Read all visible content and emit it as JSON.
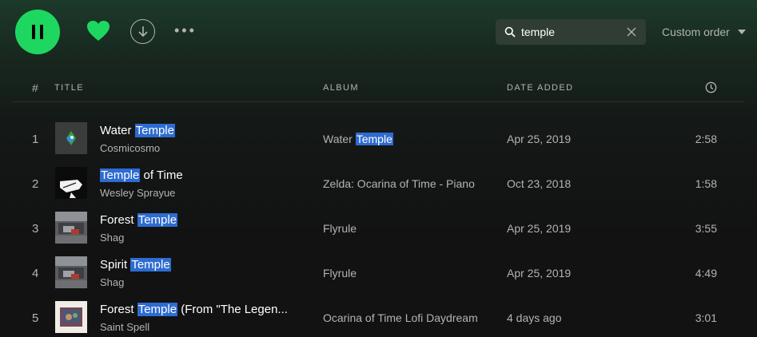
{
  "toolbar": {
    "play_state": "pause",
    "search_value": "temple",
    "sort_label": "Custom order",
    "more_label": "•••",
    "accent_color": "#1ed760"
  },
  "columns": {
    "num": "#",
    "title": "TITLE",
    "album": "ALBUM",
    "date_added": "DATE ADDED",
    "duration_icon": "clock-icon"
  },
  "tracks": [
    {
      "num": "1",
      "title_before": "Water ",
      "title_match": "Temple",
      "title_after": "",
      "artist": "Cosmicosmo",
      "album_before": "Water ",
      "album_match": "Temple",
      "album_after": "",
      "date": "Apr 25, 2019",
      "duration": "2:58"
    },
    {
      "num": "2",
      "title_before": "",
      "title_match": "Temple",
      "title_after": " of Time",
      "artist": "Wesley Sprayue",
      "album_before": "Zelda: Ocarina of Time - Piano",
      "album_match": "",
      "album_after": "",
      "date": "Oct 23, 2018",
      "duration": "1:58"
    },
    {
      "num": "3",
      "title_before": "Forest ",
      "title_match": "Temple",
      "title_after": "",
      "artist": "Shag",
      "album_before": "Flyrule",
      "album_match": "",
      "album_after": "",
      "date": "Apr 25, 2019",
      "duration": "3:55"
    },
    {
      "num": "4",
      "title_before": "Spirit ",
      "title_match": "Temple",
      "title_after": "",
      "artist": "Shag",
      "album_before": "Flyrule",
      "album_match": "",
      "album_after": "",
      "date": "Apr 25, 2019",
      "duration": "4:49"
    },
    {
      "num": "5",
      "title_before": "Forest ",
      "title_match": "Temple",
      "title_after": " (From \"The Legen...",
      "artist": "Saint Spell",
      "album_before": "Ocarina of Time Lofi Daydream",
      "album_match": "",
      "album_after": "",
      "date": "4 days ago",
      "duration": "3:01"
    }
  ]
}
